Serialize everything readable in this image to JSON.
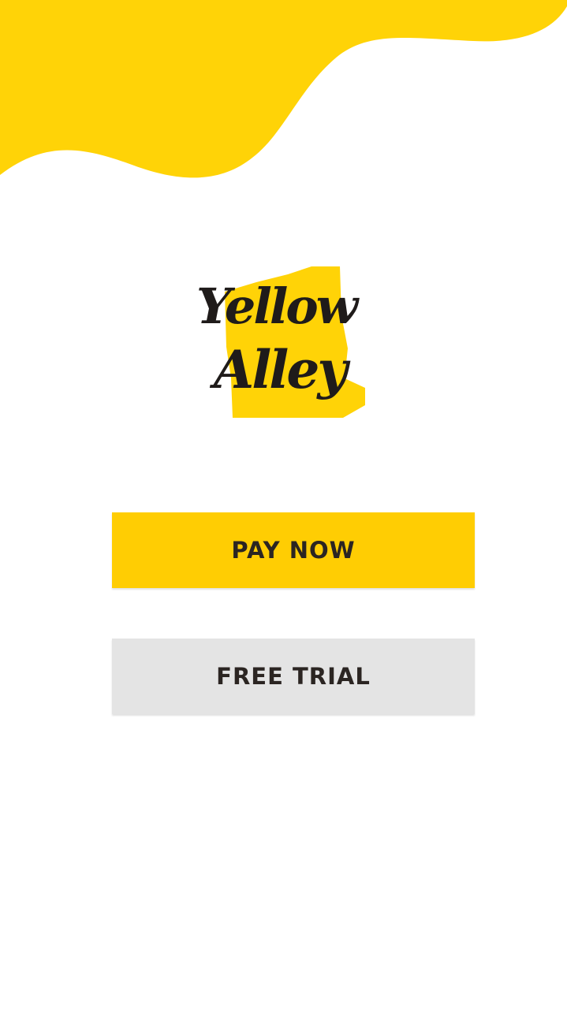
{
  "brand": {
    "line1": "Yellow",
    "line2": "Alley"
  },
  "buttons": {
    "pay_now": "PAY NOW",
    "free_trial": "FREE TRIAL"
  },
  "colors": {
    "accent_yellow": "#ffd307",
    "pay_button": "#ffcd03",
    "trial_button": "#e4e4e4",
    "text_dark": "#2b2522",
    "background": "#ffffff"
  }
}
